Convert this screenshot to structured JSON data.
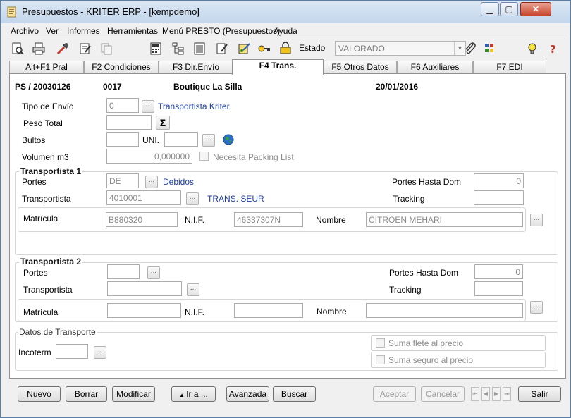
{
  "window": {
    "title": "Presupuestos - KRITER ERP - [kempdemo]"
  },
  "menu": [
    "Archivo",
    "Ver",
    "Informes",
    "Herramientas",
    "Menú PRESTO (Presupuestos)",
    "Ayuda"
  ],
  "toolbar": {
    "estado_label": "Estado",
    "estado_value": "VALORADO",
    "icons": [
      "preview-icon",
      "print-icon",
      "tools-icon",
      "edit-form-icon",
      "copy-icon",
      "calculator-icon",
      "tree-icon",
      "list-icon",
      "document-edit-icon",
      "wizard-icon",
      "key-icon",
      "lock-icon",
      "paperclip-icon",
      "grid-icon",
      "lightbulb-icon",
      "help-icon"
    ]
  },
  "tabs": [
    "Alt+F1 Pral",
    "F2 Condiciones",
    "F3 Dir.Envío",
    "F4 Trans.",
    "F5 Otros Datos",
    "F6 Auxiliares",
    "F7 EDI"
  ],
  "active_tab": "F4 Trans.",
  "header": {
    "doc": "PS / 20030126",
    "code": "0017",
    "client": "Boutique La Silla",
    "date": "20/01/2016"
  },
  "form": {
    "tipo_envio_label": "Tipo de Envío",
    "tipo_envio_value": "0",
    "tipo_envio_desc": "Transportista Kriter",
    "peso_total_label": "Peso Total",
    "peso_total_value": "",
    "bultos_label": "Bultos",
    "bultos_value": "",
    "uni_label": "UNI.",
    "uni_value": "",
    "volumen_label": "Volumen m3",
    "volumen_value": "0,000000",
    "packing_label": "Necesita Packing List"
  },
  "transportista1": {
    "title": "Transportista 1",
    "portes_label": "Portes",
    "portes_value": "DE",
    "portes_desc": "Debidos",
    "transportista_label": "Transportista",
    "transportista_value": "4010001",
    "transportista_desc": "TRANS. SEUR",
    "portes_hasta_label": "Portes Hasta Dom",
    "portes_hasta_value": "0",
    "tracking_label": "Tracking",
    "tracking_value": "",
    "matricula_label": "Matrícula",
    "matricula_value": "B880320",
    "nif_label": "N.I.F.",
    "nif_value": "46337307N",
    "nombre_label": "Nombre",
    "nombre_value": "CITROEN MEHARI"
  },
  "transportista2": {
    "title": "Transportista 2",
    "portes_label": "Portes",
    "portes_value": "",
    "transportista_label": "Transportista",
    "transportista_value": "",
    "portes_hasta_label": "Portes Hasta Dom",
    "portes_hasta_value": "0",
    "tracking_label": "Tracking",
    "tracking_value": "",
    "matricula_label": "Matrícula",
    "matricula_value": "",
    "nif_label": "N.I.F.",
    "nif_value": "",
    "nombre_label": "Nombre",
    "nombre_value": ""
  },
  "datos_transporte": {
    "title": "Datos de Transporte",
    "incoterm_label": "Incoterm",
    "incoterm_value": "",
    "suma_flete_label": "Suma flete al precio",
    "suma_seguro_label": "Suma seguro al precio"
  },
  "buttons": {
    "nuevo": "Nuevo",
    "borrar": "Borrar",
    "modificar": "Modificar",
    "ir_a": "Ir a ...",
    "avanzada": "Avanzada",
    "buscar": "Buscar",
    "aceptar": "Aceptar",
    "cancelar": "Cancelar",
    "salir": "Salir"
  }
}
